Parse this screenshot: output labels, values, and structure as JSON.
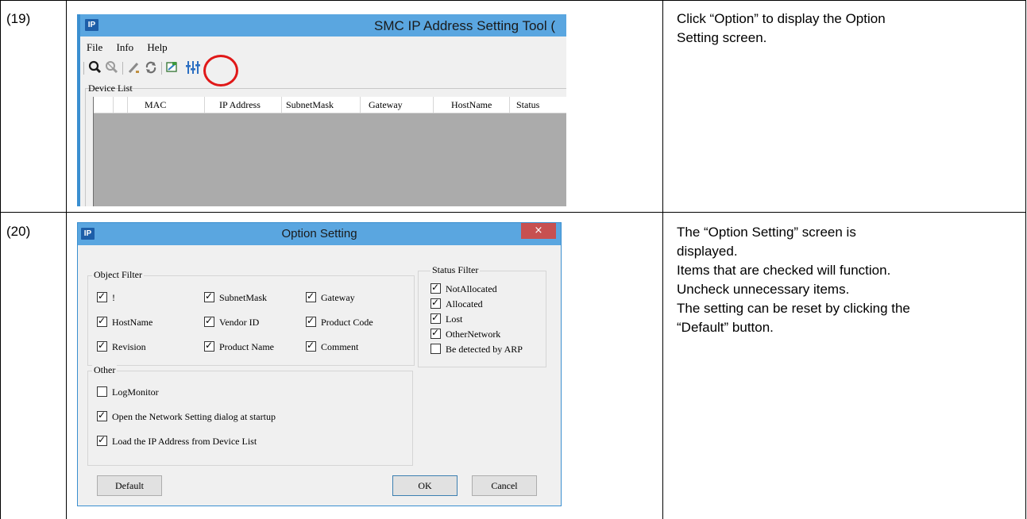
{
  "steps": [
    {
      "number": "(19)",
      "description": [
        "Click “Option” to display the Option",
        "Setting screen."
      ]
    },
    {
      "number": "(20)",
      "description": [
        "The “Option Setting” screen is",
        "displayed.",
        "Items that are checked will function.",
        "Uncheck unnecessary items.",
        "The setting can be reset by clicking the",
        "“Default” button."
      ]
    }
  ],
  "main_window": {
    "icon_text": "IP",
    "title": "SMC IP Address Setting Tool (",
    "menu": [
      "File",
      "Info",
      "Help"
    ],
    "toolbar_icons": [
      "search-icon",
      "search-disabled-icon",
      "edit-icon",
      "refresh-icon",
      "network-icon",
      "option-sliders-icon"
    ],
    "highlight_color": "#e01818",
    "device_list_label": "Device List",
    "columns": [
      "MAC",
      "IP Address",
      "SubnetMask",
      "Gateway",
      "HostName",
      "Status"
    ]
  },
  "option_dialog": {
    "icon_text": "IP",
    "title": "Option Setting",
    "close_symbol": "×",
    "object_filter": {
      "label": "Object Filter",
      "items": [
        {
          "label": "!",
          "checked": true
        },
        {
          "label": "SubnetMask",
          "checked": true
        },
        {
          "label": "Gateway",
          "checked": true
        },
        {
          "label": "HostName",
          "checked": true
        },
        {
          "label": "Vendor ID",
          "checked": true
        },
        {
          "label": "Product Code",
          "checked": true
        },
        {
          "label": "Revision",
          "checked": true
        },
        {
          "label": "Product Name",
          "checked": true
        },
        {
          "label": "Comment",
          "checked": true
        }
      ]
    },
    "status_filter": {
      "label": "Status Filter",
      "items": [
        {
          "label": "NotAllocated",
          "checked": true
        },
        {
          "label": "Allocated",
          "checked": true
        },
        {
          "label": "Lost",
          "checked": true
        },
        {
          "label": "OtherNetwork",
          "checked": true
        },
        {
          "label": "Be detected by ARP",
          "checked": false
        }
      ]
    },
    "other": {
      "label": "Other",
      "items": [
        {
          "label": "LogMonitor",
          "checked": false
        },
        {
          "label": "Open the Network Setting dialog at startup",
          "checked": true
        },
        {
          "label": "Load the IP Address from Device List",
          "checked": true
        }
      ]
    },
    "buttons": {
      "default": "Default",
      "ok": "OK",
      "cancel": "Cancel"
    }
  }
}
